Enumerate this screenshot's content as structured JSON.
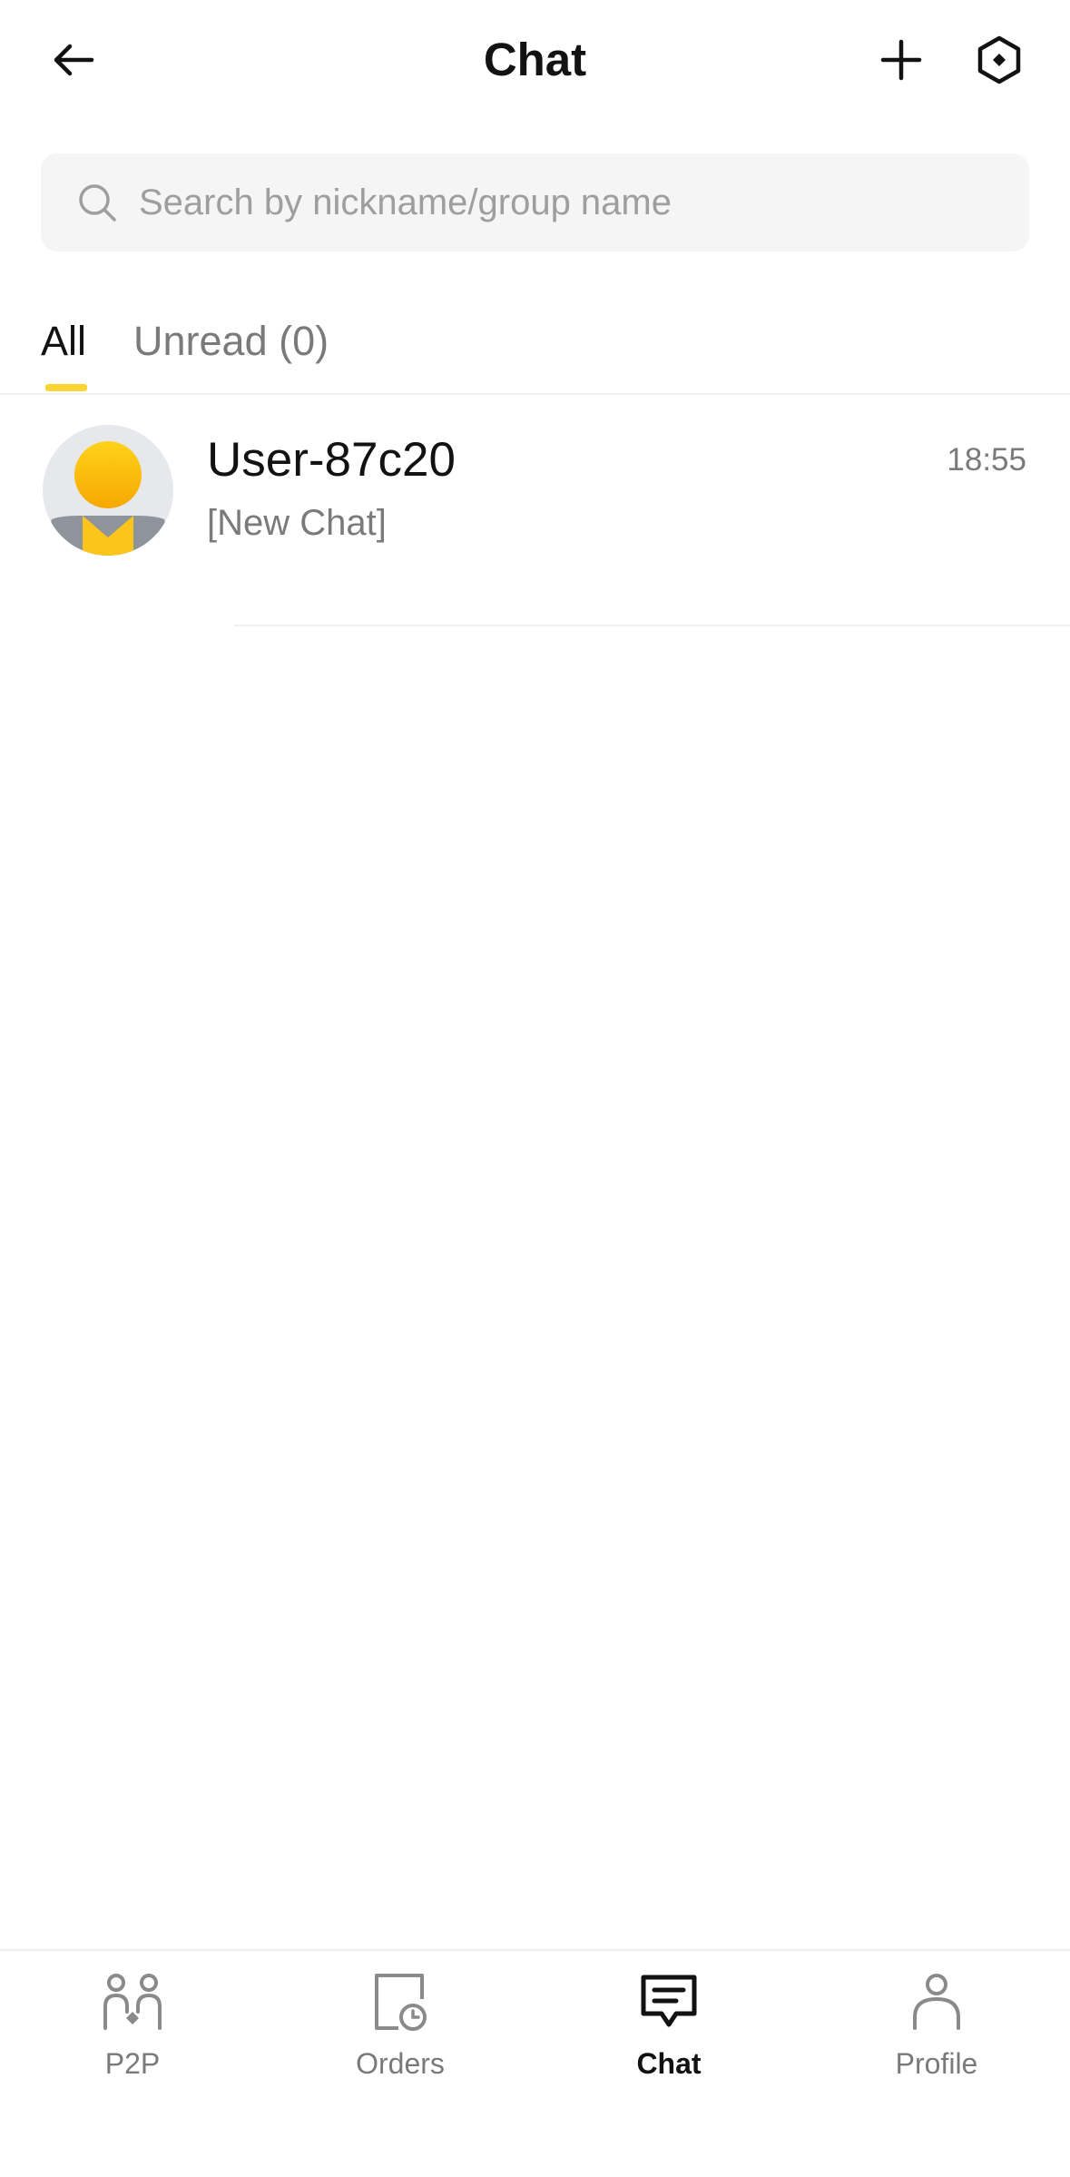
{
  "header": {
    "title": "Chat",
    "back_icon": "arrow-left-icon",
    "add_icon": "plus-icon",
    "settings_icon": "hexagon-settings-icon"
  },
  "search": {
    "placeholder": "Search by nickname/group name",
    "value": ""
  },
  "tabs": [
    {
      "label": "All",
      "active": true
    },
    {
      "label": "Unread (0)",
      "active": false
    }
  ],
  "colors": {
    "accent": "#fcd535",
    "text_primary": "#121212",
    "text_secondary": "#7a7a7a",
    "search_bg": "#f5f5f5"
  },
  "chats": [
    {
      "name": "User-87c20",
      "preview": "[New Chat]",
      "time": "18:55",
      "avatar": "default-avatar-icon"
    }
  ],
  "bottom_nav": [
    {
      "label": "P2P",
      "icon": "p2p-users-icon",
      "active": false
    },
    {
      "label": "Orders",
      "icon": "orders-clock-icon",
      "active": false
    },
    {
      "label": "Chat",
      "icon": "chat-bubble-icon",
      "active": true
    },
    {
      "label": "Profile",
      "icon": "profile-person-icon",
      "active": false
    }
  ]
}
